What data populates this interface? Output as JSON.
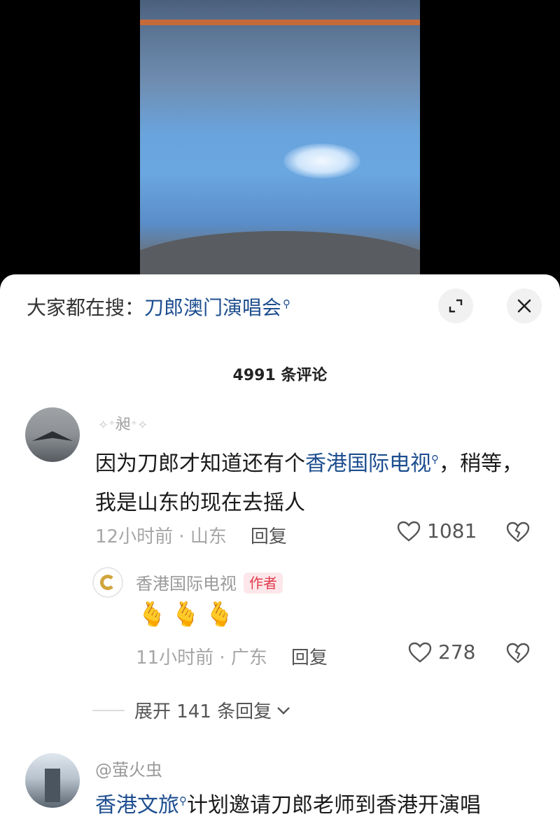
{
  "search": {
    "prefix": "大家都在搜：",
    "term": "刀郎澳门演唱会"
  },
  "comments_count": "4991 条评论",
  "comments": [
    {
      "username": "昶",
      "text_before_link": "因为刀郎才知道还有个",
      "link": "香港国际电视",
      "text_after_link": "，稍等，我是山东的现在去摇人",
      "time": "12小时前",
      "location": "山东",
      "reply_label": "回复",
      "likes": "1081"
    }
  ],
  "author_reply": {
    "username": "香港国际电视",
    "badge": "作者",
    "emoji": "🫰🫰🫰",
    "time": "11小时前",
    "location": "广东",
    "reply_label": "回复",
    "likes": "278"
  },
  "expand": {
    "label": "展开 141 条回复"
  },
  "comment3": {
    "username": "@萤火虫",
    "link": "香港文旅",
    "text": "计划邀请刀郎老师到香港开演唱"
  },
  "colors": {
    "link": "#1d4e8f",
    "badge": "#e03a4c",
    "meta": "#a6a6a6"
  },
  "icons": [
    "expand-icon",
    "close-icon",
    "heart-icon",
    "heartbreak-icon",
    "chevron-down-icon",
    "search-glyph-icon"
  ]
}
